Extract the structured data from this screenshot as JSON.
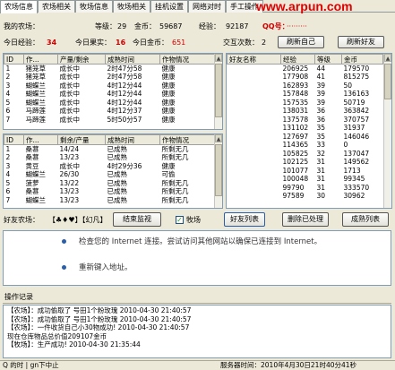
{
  "tabs": [
    "农场信息",
    "农场相关",
    "牧场信息",
    "牧场相关",
    "挂机设置",
    "网络对时",
    "手工操作"
  ],
  "watermark": "www.arpun.com",
  "header": {
    "my_farm_label": "我的农场：",
    "level_label": "等级：",
    "level_value": "29",
    "gold_label": "金币：",
    "gold_value": "59687",
    "exp_label": "经验：",
    "exp_value": "92187",
    "qq_label": "QQ号：",
    "qq_value": "·········",
    "today_exp_label": "今日经验：",
    "today_exp_value": "34",
    "today_fruit_label": "今日果实：",
    "today_fruit_value": "16",
    "today_gold_label": "今日金币：",
    "today_gold_value": "651",
    "interact_label": "交互次数：",
    "interact_value": "2",
    "refresh_self": "刷新自己",
    "refresh_friends": "刷新好友"
  },
  "farm_table": {
    "headers": [
      "ID",
      "作...",
      "产量/剩余",
      "成熟时间",
      "作物情况"
    ],
    "rows": [
      [
        "1",
        "猪笼草",
        "成长中",
        "2时47分58",
        "健康"
      ],
      [
        "2",
        "猪笼草",
        "成长中",
        "2时47分58",
        "健康"
      ],
      [
        "3",
        "蝴蝶兰",
        "成长中",
        "4时12分44",
        "健康"
      ],
      [
        "4",
        "蝴蝶兰",
        "成长中",
        "4时12分44",
        "健康"
      ],
      [
        "5",
        "蝴蝶兰",
        "成长中",
        "4时12分44",
        "健康"
      ],
      [
        "6",
        "马蹄莲",
        "成长中",
        "4时12分37",
        "健康"
      ],
      [
        "7",
        "马蹄莲",
        "成长中",
        "5时50分57",
        "健康"
      ]
    ]
  },
  "pasture_table": {
    "headers": [
      "ID",
      "作...",
      "剩余/产量",
      "成熟时间",
      "作物情况"
    ],
    "rows": [
      [
        "1",
        "桑葚",
        "14/24",
        "已成熟",
        "所剩无几"
      ],
      [
        "2",
        "桑葚",
        "13/23",
        "已成熟",
        "所剩无几"
      ],
      [
        "3",
        "黄豆",
        "成长中",
        "4时29分36",
        "健康"
      ],
      [
        "4",
        "蝴蝶兰",
        "26/30",
        "已成熟",
        "可偷"
      ],
      [
        "5",
        "菠萝",
        "13/22",
        "已成熟",
        "所剩无几"
      ],
      [
        "6",
        "桑葚",
        "13/23",
        "已成熟",
        "所剩无几"
      ],
      [
        "7",
        "蝴蝶兰",
        "13/23",
        "已成熟",
        "所剩无几"
      ]
    ]
  },
  "friends_table": {
    "headers": [
      "好友名称",
      "经验",
      "等级",
      "金币"
    ],
    "rows": [
      [
        "",
        "206925",
        "44",
        "179570"
      ],
      [
        "",
        "177908",
        "41",
        "815275"
      ],
      [
        "",
        "162893",
        "39",
        "50"
      ],
      [
        "",
        "157848",
        "39",
        "136163"
      ],
      [
        "",
        "157535",
        "39",
        "50719"
      ],
      [
        "",
        "138031",
        "36",
        "363842"
      ],
      [
        "",
        "137578",
        "36",
        "370757"
      ],
      [
        "",
        "131102",
        "35",
        "31937"
      ],
      [
        "",
        "127697",
        "35",
        "146046"
      ],
      [
        "",
        "114365",
        "33",
        "0"
      ],
      [
        "",
        "105825",
        "32",
        "137047"
      ],
      [
        "",
        "102125",
        "31",
        "149562"
      ],
      [
        "",
        "101077",
        "31",
        "1713"
      ],
      [
        "",
        "100048",
        "31",
        "99345"
      ],
      [
        "",
        "99790",
        "31",
        "333570"
      ],
      [
        "",
        "97589",
        "30",
        "30962"
      ]
    ]
  },
  "controls": {
    "friend_farm_label": "好友农场：",
    "friend_farm_value": "【♣♦♥】【幻凡】",
    "end_monitor": "结束监视",
    "pasture_label": "牧场",
    "friend_list": "好友列表",
    "delete_processed": "删除已处理",
    "mature_list": "成熟列表"
  },
  "browser": {
    "msg1": "检查您的 Internet 连接。尝试访问其他网站以确保已连接到 Internet。",
    "msg2": "重新键入地址。"
  },
  "log": {
    "title": "操作记录",
    "lines": [
      "【农场】：成功偷取了      号田1个粉玫瑰      2010-04-30 21:40:57",
      "【农场】：成功偷取了      号田1个粉玫瑰      2010-04-30 21:40:57",
      "【农场】：一件收货自己小30物成功!      2010-04-30 21:40:57",
      "现在仓库物品总价值209107金币",
      "【牧场】：生产成功!              2010-04-30 21:35:44"
    ]
  },
  "status": {
    "left": "Q  的时  |   gn下中止",
    "right": "服务器时间：2010年4月30日21时40分41秒"
  }
}
